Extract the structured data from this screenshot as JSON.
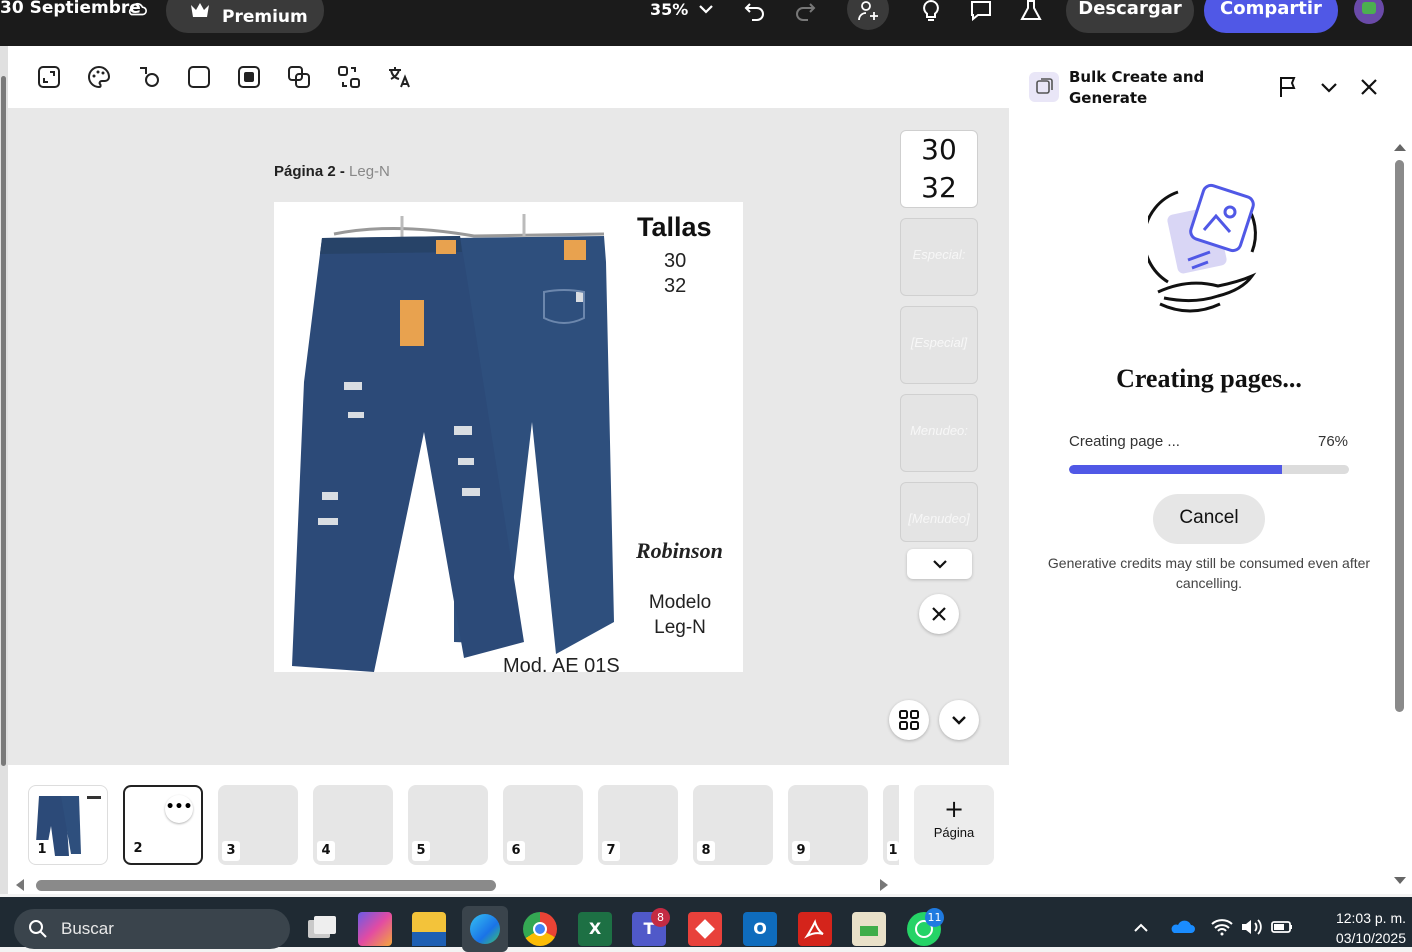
{
  "topbar": {
    "doc_title": "30 Septiembre",
    "premium_label": "Premium",
    "zoom_value": "35%",
    "download_label": "Descargar",
    "share_label": "Compartir"
  },
  "editor": {
    "page_label_prefix": "Página 2 - ",
    "page_label_name": "Leg-N",
    "artboard": {
      "tallas_title": "Tallas",
      "tallas_values": [
        "30",
        "32"
      ],
      "brand": "Robinson",
      "modelo_line1": "Modelo",
      "modelo_line2": "Leg-N",
      "footer_text": "Mod. AE 01S"
    },
    "side_cards": [
      {
        "line1": "30",
        "line2": "32"
      },
      {
        "placeholder": "Especial:"
      },
      {
        "placeholder": "[Especial]"
      },
      {
        "placeholder": "Menudeo:"
      },
      {
        "placeholder": "[Menudeo]"
      }
    ]
  },
  "filmstrip": {
    "pages": [
      "1",
      "2",
      "3",
      "4",
      "5",
      "6",
      "7",
      "8",
      "9",
      "1"
    ],
    "selected_page": "2",
    "add_page_label": "Página",
    "add_page_plus": "+"
  },
  "panel": {
    "title": "Bulk Create and Generate",
    "heading": "Creating pages...",
    "progress_label": "Creating page ...",
    "progress_text": "76%",
    "progress_fraction": 0.76,
    "cancel_label": "Cancel",
    "note": "Generative credits may still be consumed even after cancelling."
  },
  "taskbar": {
    "search_placeholder": "Buscar",
    "teams_badge": "8",
    "whatsapp_badge": "11",
    "time": "12:03 p. m.",
    "date": "03/10/2025"
  },
  "colors": {
    "accent": "#5058e6",
    "topbar_bg": "#1b1b1b",
    "taskbar_bg": "#1f2a33"
  }
}
